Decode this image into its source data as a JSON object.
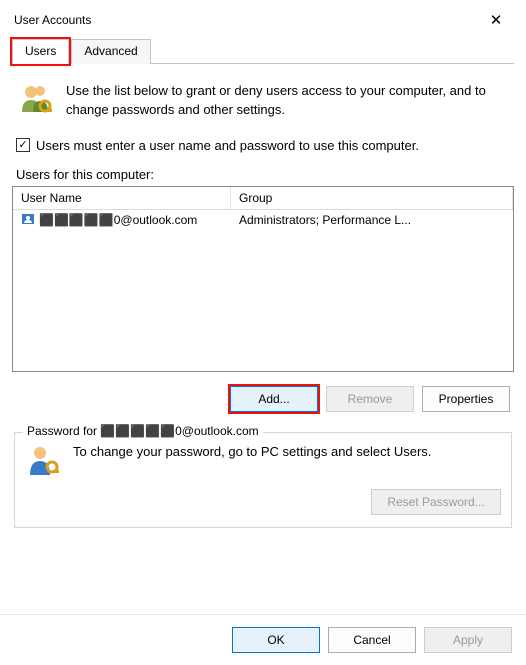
{
  "window": {
    "title": "User Accounts"
  },
  "tabs": {
    "users": "Users",
    "advanced": "Advanced"
  },
  "intro": "Use the list below to grant or deny users access to your computer, and to change passwords and other settings.",
  "checkbox_label": "Users must enter a user name and password to use this computer.",
  "list_heading": "Users for this computer:",
  "columns": {
    "name": "User Name",
    "group": "Group"
  },
  "rows": [
    {
      "name": "⬛⬛⬛⬛⬛0@outlook.com",
      "group": "Administrators; Performance L..."
    }
  ],
  "buttons": {
    "add": "Add...",
    "remove": "Remove",
    "properties": "Properties",
    "reset_pw": "Reset Password...",
    "ok": "OK",
    "cancel": "Cancel",
    "apply": "Apply"
  },
  "password_group": {
    "legend_prefix": "Password for",
    "legend_user": "⬛⬛⬛⬛⬛0@outlook.com",
    "text": "To change your password, go to PC settings and select Users."
  }
}
